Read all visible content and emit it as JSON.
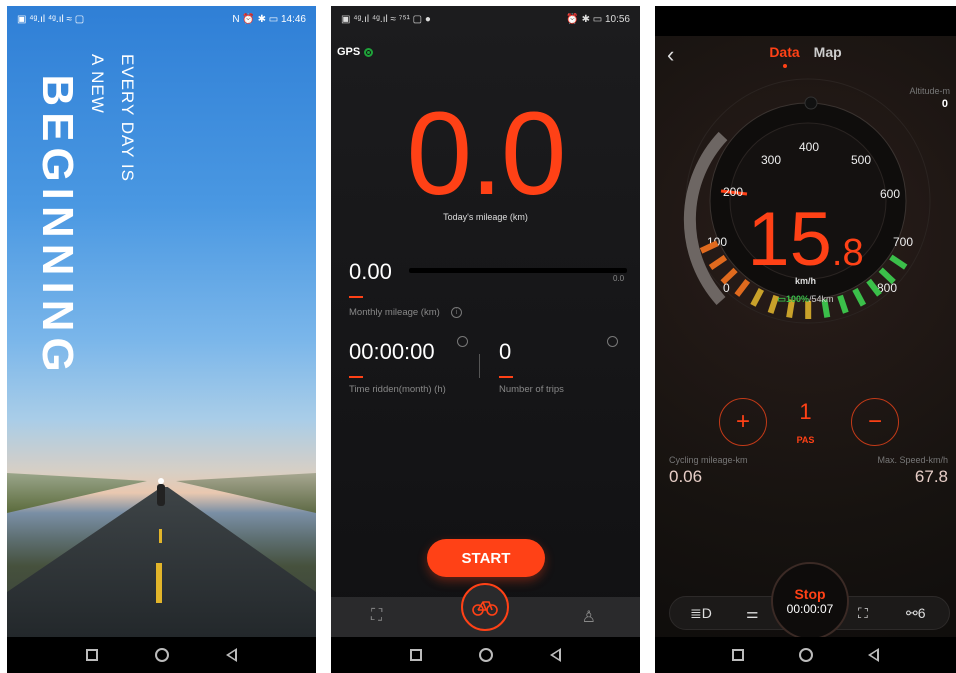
{
  "screen1": {
    "status": {
      "left": "▣ ⁴ᵍ.ıl ⁴ᵍ.ıl ≈ ▢",
      "right": "N ⏰ ✱ ▭ 14:46"
    },
    "headline": "BEGINNING",
    "tagline_line1": "EVERY DAY IS",
    "tagline_line2": "A NEW"
  },
  "screen2": {
    "status": {
      "left": "▣ ⁴ᵍ.ıl ⁴ᵍ.ıl ≈ ⁷⁵¹ ▢ ●",
      "right": "⏰ ✱ ▭ 10:56"
    },
    "gps_label": "GPS",
    "today_value": "0.0",
    "today_label": "Today's mileage  (km)",
    "monthly_value": "0.00",
    "monthly_bar_end": "0.0",
    "monthly_label": "Monthly mileage   (km)",
    "time_value": "00:00:00",
    "time_label": "Time ridden(month)   (h)",
    "trips_value": "0",
    "trips_label": "Number of trips",
    "start_label": "START"
  },
  "screen3": {
    "tabs": [
      "Data",
      "Map"
    ],
    "altitude_label": "Altitude-m",
    "altitude_value": "0",
    "gauge_ticks": [
      "0",
      "100",
      "200",
      "300",
      "400",
      "500",
      "600",
      "700",
      "800"
    ],
    "speed_integer": "15",
    "speed_decimal": ".8",
    "speed_unit": "km/h",
    "battery_percent": "100%",
    "battery_range": "/54km",
    "pas_label": "PAS",
    "pas_value": "1",
    "plus": "+",
    "minus": "−",
    "cycling_label": "Cycling mileage-km",
    "cycling_value": "0.06",
    "maxspeed_label": "Max. Speed-km/h",
    "maxspeed_value": "67.8",
    "stop_label": "Stop",
    "stop_time": "00:00:07",
    "gear_value": "6"
  },
  "colors": {
    "accent": "#ff4116",
    "battery_green": "#3bbf4a"
  }
}
